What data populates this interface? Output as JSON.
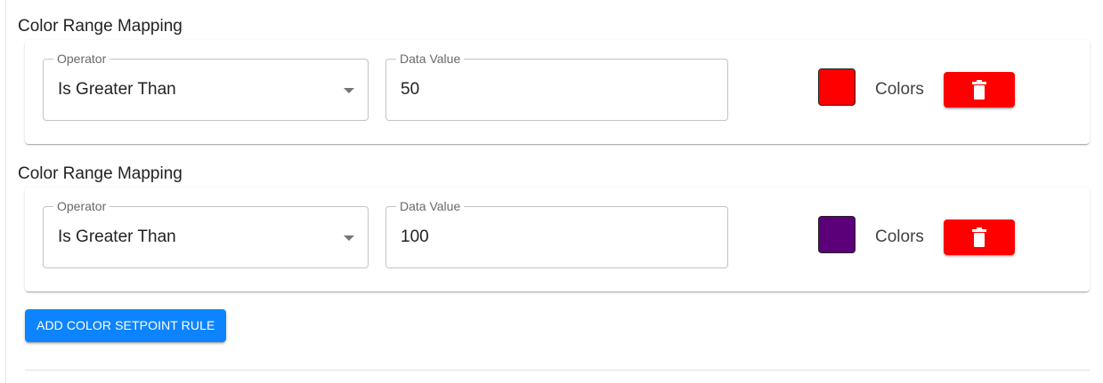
{
  "rules": [
    {
      "section_title": "Color Range Mapping",
      "operator_label": "Operator",
      "operator_value": "Is Greater Than",
      "data_value_label": "Data Value",
      "data_value": "50",
      "color": "#ff0000",
      "colors_label": "Colors",
      "delete_icon": "trash-icon"
    },
    {
      "section_title": "Color Range Mapping",
      "operator_label": "Operator",
      "operator_value": "Is Greater Than",
      "data_value_label": "Data Value",
      "data_value": "100",
      "color": "#5c007a",
      "colors_label": "Colors",
      "delete_icon": "trash-icon"
    }
  ],
  "add_button_label": "ADD COLOR SETPOINT RULE",
  "theme": {
    "delete_button_color": "#ff0000",
    "primary_button_color": "#0d84ff"
  }
}
